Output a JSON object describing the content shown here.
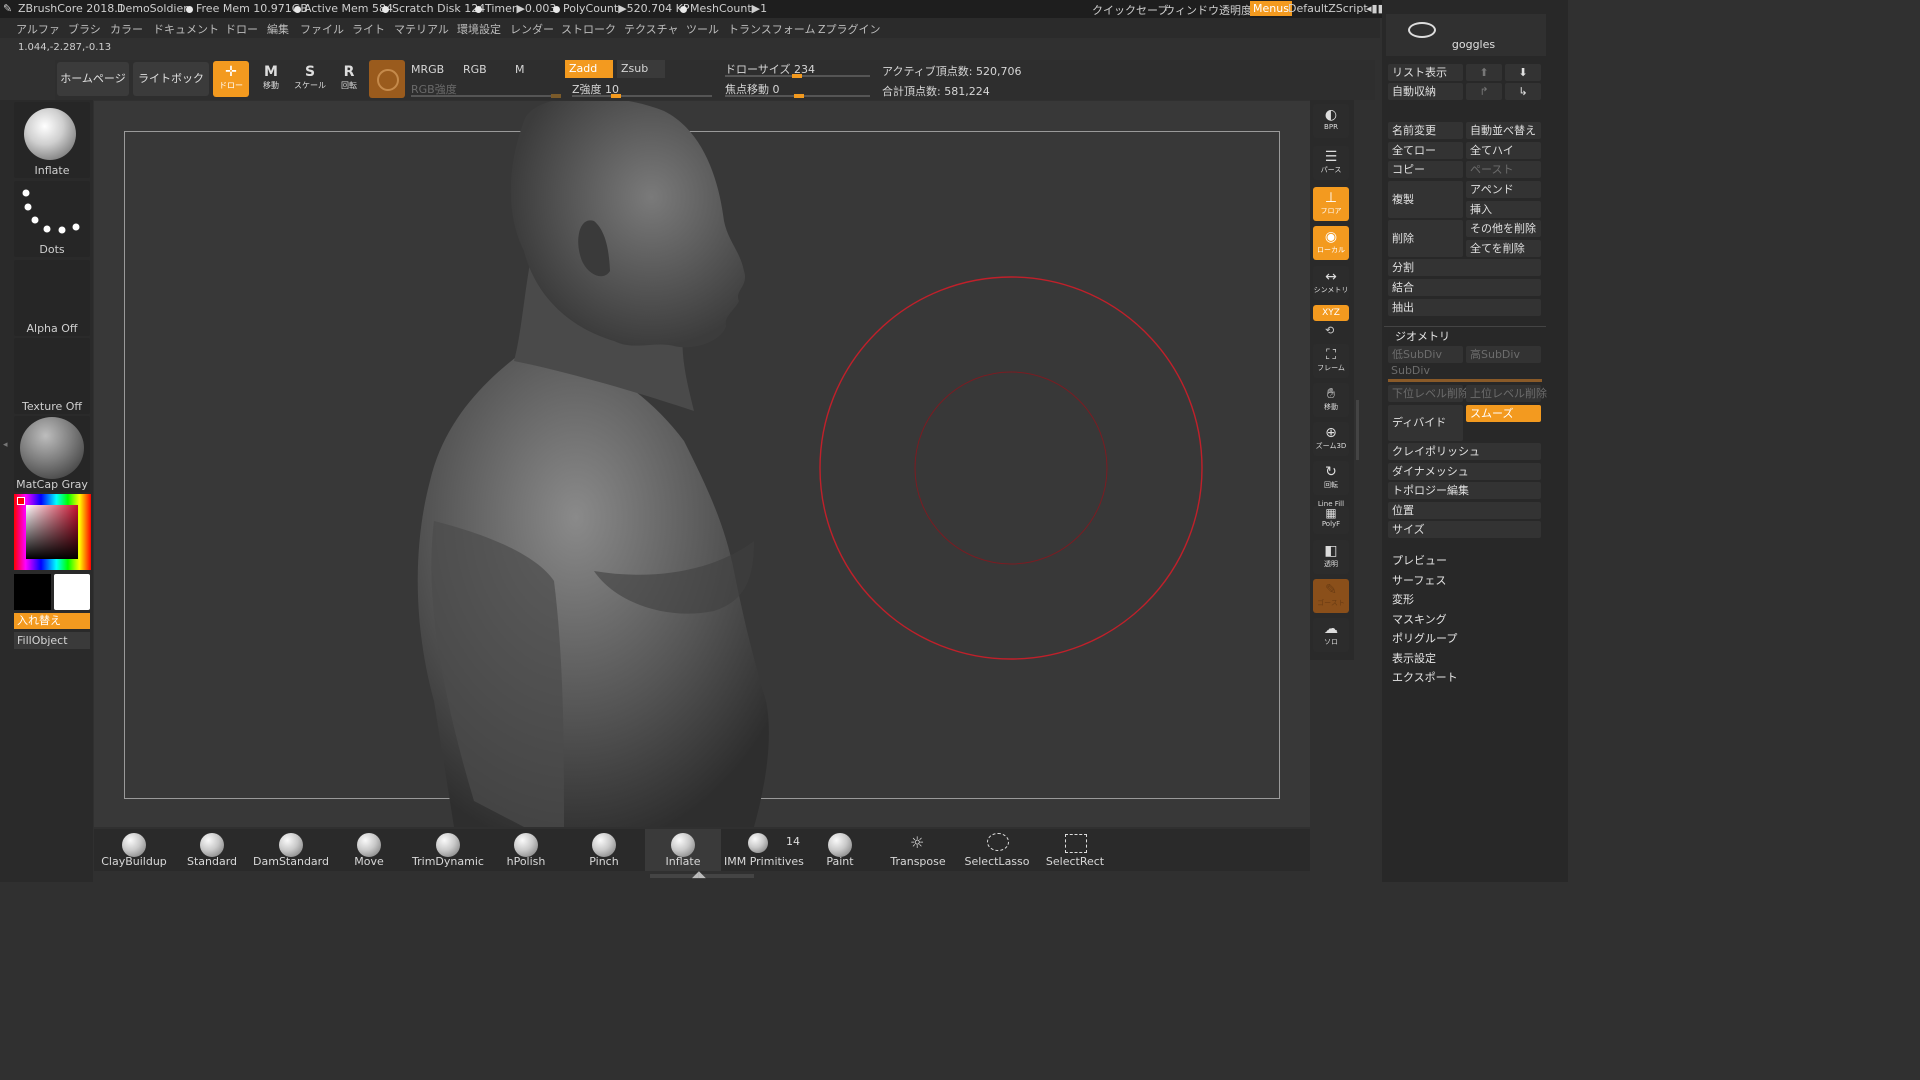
{
  "titlebar": {
    "app": "ZBrushCore 2018.1",
    "user": "DemoSoldier",
    "free_mem": "Free Mem 10.971GB",
    "active_mem": "Active Mem 584",
    "scratch": "Scratch Disk 124",
    "timer": "Timer▶0.003",
    "polycount": "PolyCount▶520.704 KP",
    "meshcount": "MeshCount▶1",
    "quicksave": "クイックセーブ",
    "win_transparency": "ウィンドウ透明度",
    "menus": "Menus",
    "zscript": "DefaultZScript"
  },
  "menubar": [
    "アルファ",
    "ブラシ",
    "カラー",
    "ドキュメント",
    "ドロー",
    "編集",
    "ファイル",
    "ライト",
    "マテリアル",
    "環境設定",
    "レンダー",
    "ストローク",
    "テクスチャ",
    "ツール",
    "トランスフォーム",
    "Zプラグイン"
  ],
  "coords": "1.044,-2.287,-0.13",
  "toolbar": {
    "homepage": "ホームページ",
    "lightbox": "ライトボックス",
    "draw_label": "ドロー",
    "move_label": "移動",
    "scale_label": "スケール",
    "rotate_label": "回転",
    "mrgb": "MRGB",
    "rgb": "RGB",
    "m": "M",
    "zadd": "Zadd",
    "zsub": "Zsub",
    "rgb_intensity": "RGB強度",
    "z_intensity": "Z強度 10",
    "draw_size": "ドローサイズ 234",
    "focal_shift": "焦点移動 0",
    "active_points": "アクティブ頂点数: 520,706",
    "total_points": "合計頂点数: 581,224"
  },
  "left_shelf": {
    "brush": "Inflate",
    "stroke": "Dots",
    "alpha": "Alpha Off",
    "texture": "Texture Off",
    "material": "MatCap Gray",
    "swap": "入れ替え",
    "fill": "FillObject"
  },
  "right_icons": [
    {
      "name": "bpr",
      "label": "BPR"
    },
    {
      "name": "perspective",
      "label": "パース"
    },
    {
      "name": "floor",
      "label": "フロア"
    },
    {
      "name": "local",
      "label": "ローカル"
    },
    {
      "name": "symmetry",
      "label": "シンメトリ"
    },
    {
      "name": "xyz",
      "label": "XYZ"
    },
    {
      "name": "frame",
      "label": "フレーム"
    },
    {
      "name": "move",
      "label": "移動"
    },
    {
      "name": "zoom3d",
      "label": "ズーム3D"
    },
    {
      "name": "rotate",
      "label": "回転"
    },
    {
      "name": "polyf",
      "label": "PolyF"
    },
    {
      "name": "transp",
      "label": "透明"
    },
    {
      "name": "ghost",
      "label": "ゴースト"
    },
    {
      "name": "solo",
      "label": "ソロ"
    }
  ],
  "line_fill": "Line Fill",
  "subtool": {
    "name": "goggles",
    "list_view": "リスト表示",
    "auto_collapse": "自動収納",
    "rename": "名前変更",
    "auto_reorder": "自動並べ替え",
    "all_low": "全てロー",
    "all_high": "全てハイ",
    "copy": "コピー",
    "paste": "ペースト",
    "duplicate": "複製",
    "append": "アペンド",
    "insert": "挿入",
    "delete": "削除",
    "del_other": "その他を削除",
    "del_all": "全てを削除",
    "split": "分割",
    "merge": "結合",
    "extract": "抽出"
  },
  "geometry": {
    "title": "ジオメトリ",
    "lower_subdiv": "低SubDiv",
    "higher_subdiv": "高SubDiv",
    "subdiv": "SubDiv",
    "del_lower": "下位レベル削除",
    "del_higher": "上位レベル削除",
    "divide": "ディバイド",
    "smooth": "スムーズ",
    "claypolish": "クレイポリッシュ",
    "dynamesh": "ダイナメッシュ",
    "topology": "トポロジー編集",
    "position": "位置",
    "size": "サイズ"
  },
  "sections": [
    "プレビュー",
    "サーフェス",
    "変形",
    "マスキング",
    "ポリグループ",
    "表示設定",
    "エクスポート"
  ],
  "brushes": [
    "ClayBuildup",
    "Standard",
    "DamStandard",
    "Move",
    "TrimDynamic",
    "hPolish",
    "Pinch",
    "Inflate",
    "IMM Primitives",
    "Paint",
    "Transpose",
    "SelectLasso",
    "SelectRect"
  ],
  "imm_count": "14",
  "colors": {
    "accent": "#f39a1f",
    "brush_circle": "#c0202a"
  }
}
